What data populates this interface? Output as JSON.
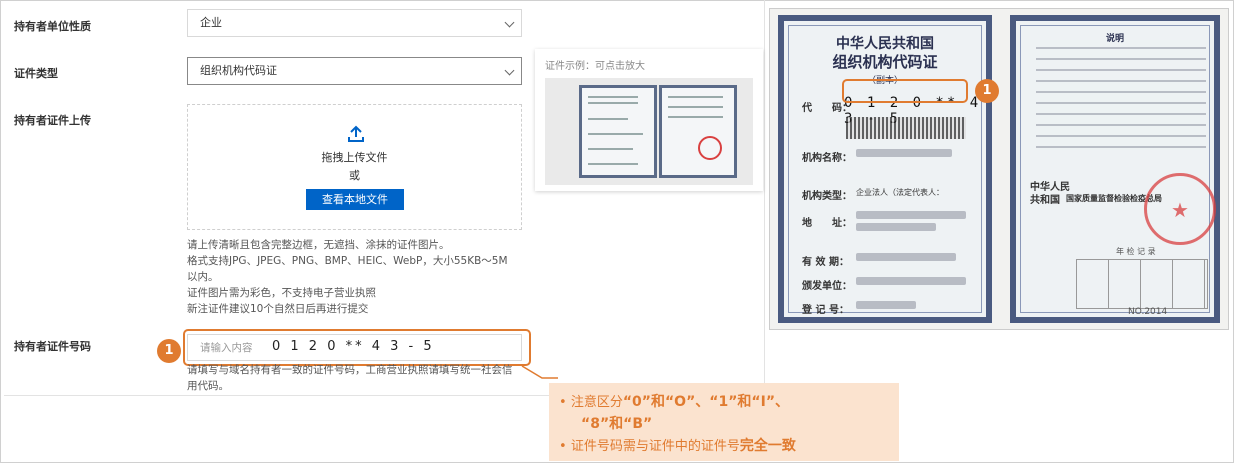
{
  "form": {
    "holder_nature": {
      "label": "持有者单位性质",
      "value": "企业"
    },
    "cert_type": {
      "label": "证件类型",
      "value": "组织机构代码证"
    },
    "upload": {
      "label": "持有者证件上传",
      "drag_text": "拖拽上传文件",
      "or_text": "或",
      "button": "查看本地文件",
      "hints": [
        "请上传清晰且包含完整边框，无遮挡、涂抹的证件图片。",
        "格式支持JPG、JPEG、PNG、BMP、HEIC、WebP，大小55KB～5M",
        "以内。",
        "证件图片需为彩色，不支持电子营业执照",
        "新注证件建议10个自然日后再进行提交"
      ]
    },
    "cert_number": {
      "label": "持有者证件号码",
      "placeholder": "请输入内容",
      "value": "0 1 2 0 ** 4 3 - 5",
      "hints": [
        "请填写与域名持有者一致的证件号码，工商营业执照请填写统一社会信",
        "用代码。"
      ]
    }
  },
  "example": {
    "caption": "证件示例：可点击放大"
  },
  "badge_number": "1",
  "callout": {
    "row1_prefix": "注意区分",
    "row1_bold": "“0”和“O”、“1”和“I”、",
    "row2_bold": "“8”和“B”",
    "row3_prefix": "证件号码需与证件中的证件号",
    "row3_bold": "完全一致"
  },
  "document": {
    "title1": "中华人民共和国",
    "title2": "组织机构代码证",
    "subtitle": "（副本）",
    "code_label": "代　　码：",
    "code_value": "0 1 2 0 ** 4 3 - 5",
    "fields": [
      "机构名称：",
      "机构类型：",
      "地　　址：",
      "有 效 期：",
      "颁发单位：",
      "登 记 号："
    ],
    "org_type_value": "企业法人（法定代表人：",
    "no_text": "NO.2014",
    "right_header": "说明",
    "right_country": "中华人民共和国",
    "right_bureau": "国家质量监督检验检疫总局",
    "annual": "年 检 记 录"
  },
  "colors": {
    "accent": "#e07b30",
    "primary_button": "#0064c8",
    "callout_bg": "#fbe3cf"
  }
}
